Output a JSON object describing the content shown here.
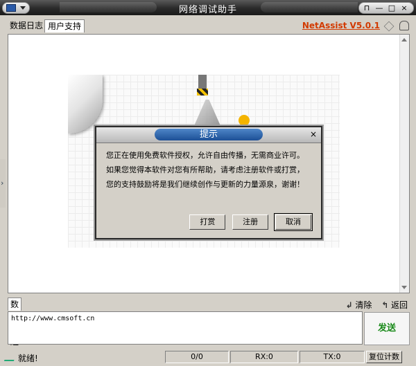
{
  "window": {
    "title": "网络调试助手"
  },
  "title_controls": {
    "pin": "⊓",
    "minimize": "—",
    "maximize": "□",
    "close": "×"
  },
  "tabs": [
    {
      "label": "数据日志",
      "active": false
    },
    {
      "label": "用户支持",
      "active": true
    }
  ],
  "brand": {
    "name": "NetAssist V5.0.1",
    "color": "#d23a00"
  },
  "dialog": {
    "title": "提示",
    "close": "×",
    "lines": [
      "您正在使用免费软件授权，允许自由传播，无需商业许可。",
      "如果您觉得本软件对您有所帮助，请考虑注册软件或打赏，",
      "您的支持鼓励将是我们继续创作与更新的力量源泉，谢谢！"
    ],
    "buttons": {
      "donate": "打赏",
      "register": "注册",
      "cancel": "取消"
    }
  },
  "send": {
    "tab": "数据发送",
    "clear_label": "清除",
    "back_label": "返回",
    "value": "http://www.cmsoft.cn",
    "send_button": "发送"
  },
  "status": {
    "ready": "就绪!",
    "counter": "0/0",
    "rx": "RX:0",
    "tx": "TX:0",
    "reset_button": "复位计数"
  },
  "icons": {
    "system": "computer-icon",
    "diamond": "diamond-icon",
    "bell": "bell-icon",
    "clear": "clear-arrow-icon",
    "back": "back-arrow-icon",
    "status": "check-icon"
  }
}
